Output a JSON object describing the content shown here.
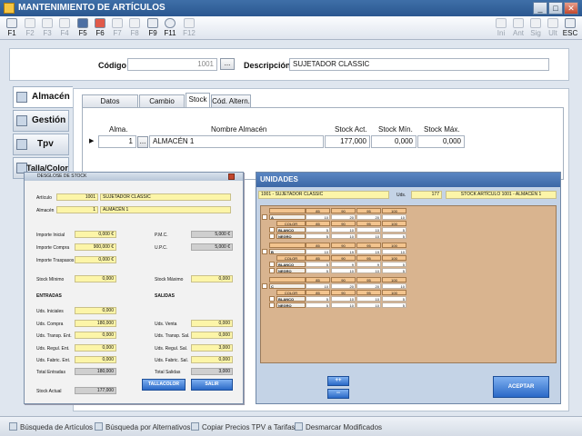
{
  "window": {
    "title": "MANTENIMIENTO DE ARTÍCULOS"
  },
  "toolbar": {
    "left": [
      "F1",
      "F2",
      "F3",
      "F4",
      "F5",
      "F6",
      "F7",
      "F8",
      "F9",
      "F11",
      "F12"
    ],
    "right": [
      "Ini",
      "Ant",
      "Sig",
      "Ult",
      "ESC"
    ]
  },
  "header": {
    "codigo_label": "Código",
    "codigo_value": "1001",
    "browse": "...",
    "descripcion_label": "Descripción",
    "descripcion_value": "SUJETADOR CLASSIC"
  },
  "left_tabs": [
    "Almacén",
    "Gestión",
    "Tpv",
    "Talla/Color"
  ],
  "tabs": [
    "Datos Generales",
    "Cambio Prec.",
    "Stock",
    "Cód. Altern."
  ],
  "stock_grid": {
    "headers": [
      "Alma.",
      "Nombre Almacén",
      "Stock Act.",
      "Stock Mín.",
      "Stock Máx."
    ],
    "row": {
      "marker": "▶",
      "alma": "1",
      "browse": "...",
      "nombre": "ALMACÉN 1",
      "stock_act": "177,000",
      "stock_min": "0,000",
      "stock_max": "0,000"
    }
  },
  "statusbar": [
    "Búsqueda de Artículos",
    "Búsqueda por Alternativos",
    "Copiar Precios TPV a Tarifas",
    "Desmarcar Modificados"
  ],
  "desglose": {
    "title": "DESGLOSE DE STOCK",
    "articulo_label": "Artículo",
    "articulo_code": "1001",
    "articulo_name": "SUJETADOR CLASSIC",
    "almacen_label": "Almacén",
    "almacen_code": "1",
    "almacen_name": "ALMACÉN 1",
    "importe_inicial_label": "Importe Inicial",
    "importe_inicial": "0,000 €",
    "importe_compra_label": "Importe Compra",
    "importe_compra": "900,000 €",
    "importe_traspasos_label": "Importe Traspasos",
    "importe_traspasos": "0,000 €",
    "pmc_label": "P.M.C.",
    "pmc": "5,000 €",
    "upc_label": "U.P.C.",
    "upc": "5,000 €",
    "stock_minimo_label": "Stock Mínimo",
    "stock_minimo": "0,000",
    "stock_maximo_label": "Stock Máximo",
    "stock_maximo": "0,000",
    "entradas_label": "ENTRADAS",
    "salidas_label": "SALIDAS",
    "uds_iniciales_label": "Uds. Iniciales",
    "uds_iniciales": "0,000",
    "uds_compra_label": "Uds. Compra",
    "uds_compra": "180,000",
    "uds_transp_ent_label": "Uds. Transp. Ent.",
    "uds_transp_ent": "0,000",
    "uds_regul_ent_label": "Uds. Regul. Ent.",
    "uds_regul_ent": "0,000",
    "uds_fabric_ent_label": "Uds. Fabric. Ent.",
    "uds_fabric_ent": "0,000",
    "total_entradas_label": "Total Entradas",
    "total_entradas": "180,000",
    "uds_venta_label": "Uds. Venta",
    "uds_venta": "0,000",
    "uds_transp_sal_label": "Uds. Transp. Sal.",
    "uds_transp_sal": "0,000",
    "uds_regul_sal_label": "Uds. Regul. Sal.",
    "uds_regul_sal": "3,000",
    "uds_fabric_sal_label": "Uds. Fabric. Sal.",
    "uds_fabric_sal": "0,000",
    "total_salidas_label": "Total Salidas",
    "total_salidas": "3,000",
    "stock_actual_label": "Stock Actual",
    "stock_actual": "177,000",
    "btn_tallacolor": "TALLACOLOR",
    "btn_salir": "SALIR"
  },
  "unidades": {
    "title": "UNIDADES",
    "articulo": "1001 - SUJETADOR CLASSIC",
    "uds_label": "Uds.",
    "uds_value": "177",
    "stock_label": "STOCK ARTÍCULO 1001 - ALMACÉN 1",
    "sizes": [
      "85",
      "90",
      "95",
      "100"
    ],
    "groups": [
      {
        "letter": "A",
        "totals": [
          "10",
          "20",
          "20",
          "10"
        ],
        "rows": [
          {
            "color": "BLANCO",
            "vals": [
              "5",
              "10",
              "10",
              "5"
            ]
          },
          {
            "color": "NEGRO",
            "vals": [
              "5",
              "10",
              "10",
              "5"
            ]
          }
        ]
      },
      {
        "letter": "B",
        "totals": [
          "10",
          "19",
          "19",
          "10"
        ],
        "rows": [
          {
            "color": "BLANCO",
            "vals": [
              "5",
              "9",
              "9",
              "5"
            ]
          },
          {
            "color": "NEGRO",
            "vals": [
              "5",
              "10",
              "10",
              "5"
            ]
          }
        ]
      },
      {
        "letter": "C",
        "totals": [
          "10",
          "20",
          "20",
          "10"
        ],
        "rows": [
          {
            "color": "BLANCO",
            "vals": [
              "5",
              "10",
              "10",
              "5"
            ]
          },
          {
            "color": "NEGRO",
            "vals": [
              "5",
              "10",
              "10",
              "5"
            ]
          }
        ]
      }
    ],
    "color_header": "COLOR",
    "btn_plus": "++",
    "btn_minus": "--",
    "btn_aceptar": "ACEPTAR"
  }
}
